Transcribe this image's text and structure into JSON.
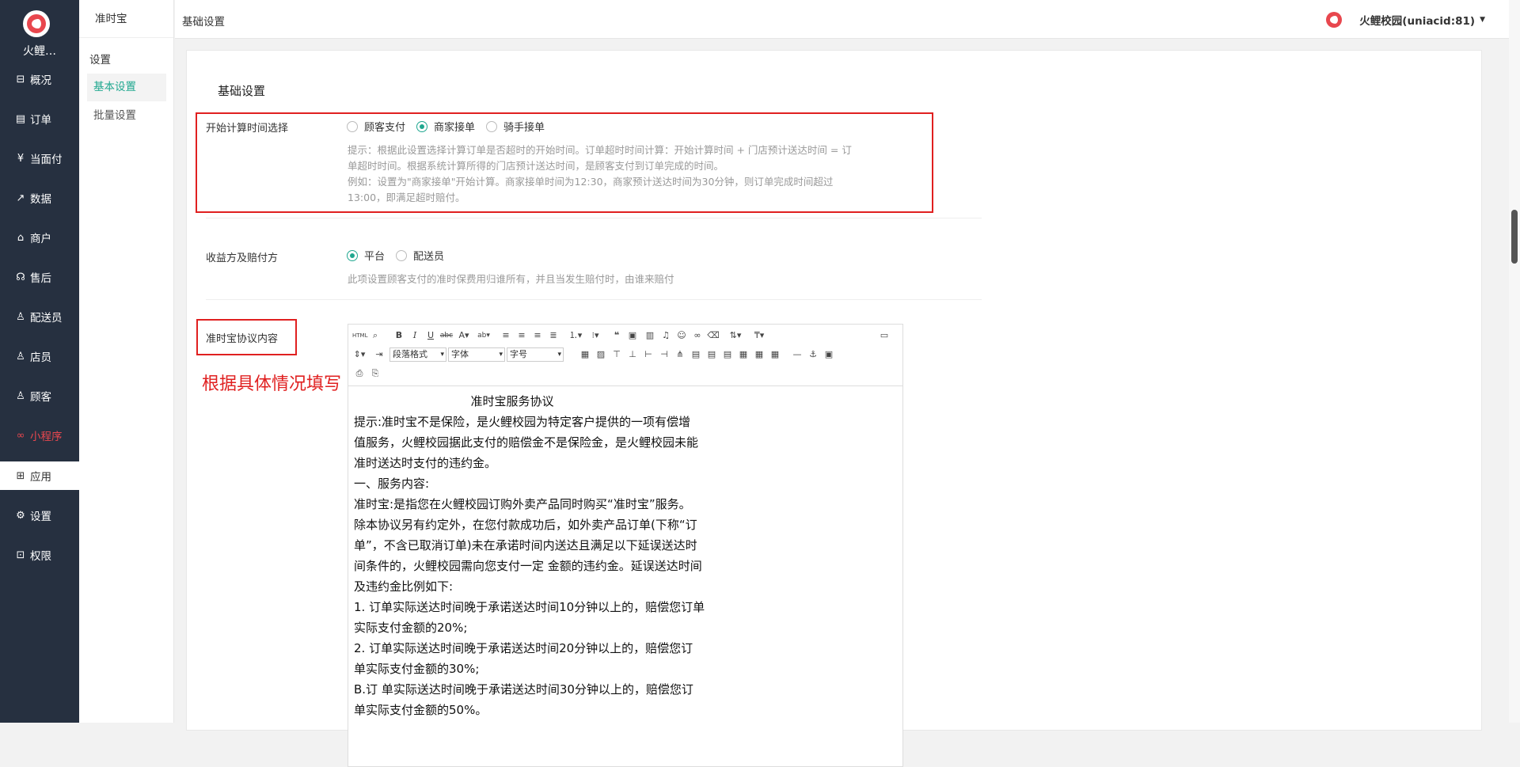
{
  "nav": {
    "brand": "火鲤…",
    "items": [
      {
        "icon": "dashboard-icon",
        "glyph": "⊟",
        "label": "概况"
      },
      {
        "icon": "order-icon",
        "glyph": "▤",
        "label": "订单"
      },
      {
        "icon": "yuan-icon",
        "glyph": "¥",
        "label": "当面付"
      },
      {
        "icon": "chart-icon",
        "glyph": "↗",
        "label": "数据"
      },
      {
        "icon": "shop-icon",
        "glyph": "⌂",
        "label": "商户"
      },
      {
        "icon": "aftersale-icon",
        "glyph": "☊",
        "label": "售后"
      },
      {
        "icon": "courier-icon",
        "glyph": "♙",
        "label": "配送员"
      },
      {
        "icon": "clerk-icon",
        "glyph": "♙",
        "label": "店员"
      },
      {
        "icon": "customer-icon",
        "glyph": "♙",
        "label": "顾客"
      },
      {
        "icon": "miniprogram-icon",
        "glyph": "∞",
        "label": "小程序"
      },
      {
        "icon": "apps-icon",
        "glyph": "⊞",
        "label": "应用"
      },
      {
        "icon": "settings-icon",
        "glyph": "⚙",
        "label": "设置"
      },
      {
        "icon": "lock-icon",
        "glyph": "⊡",
        "label": "权限"
      }
    ]
  },
  "sub": {
    "title": "准时宝",
    "group": "设置",
    "items": [
      "基本设置",
      "批量设置"
    ]
  },
  "header": {
    "breadcrumb": "基础设置",
    "user": "火鲤校园(uniacid:81)"
  },
  "main": {
    "section_title": "基础设置",
    "start_time": {
      "label": "开始计算时间选择",
      "options": [
        "顾客支付",
        "商家接单",
        "骑手接单"
      ],
      "hint1": "提示：根据此设置选择计算订单是否超时的开始时间。订单超时时间计算：开始计算时间 + 门店预计送达时间 = 订",
      "hint2": "单超时时间。根据系统计算所得的门店预计送达时间，是顾客支付到订单完成的时间。",
      "hint3": "例如：设置为\"商家接单\"开始计算。商家接单时间为12:30，商家预计送达时间为30分钟，则订单完成时间超过",
      "hint4": "13:00，即满足超时赔付。"
    },
    "beneficiary": {
      "label": "收益方及赔付方",
      "options": [
        "平台",
        "配送员"
      ],
      "hint": "此项设置顾客支付的准时保费用归谁所有，并且当发生赔付时，由谁来赔付"
    },
    "agreement": {
      "label": "准时宝协议内容",
      "annotation": "根据具体情况填写"
    }
  },
  "editor": {
    "paragraph_format": "段落格式",
    "font": "字体",
    "font_size": "字号",
    "html_label": "HTML",
    "content": [
      "准时宝服务协议",
      "提示:准时宝不是保险，是火鲤校园为特定客户提供的一项有偿增",
      "值服务，火鲤校园据此支付的赔偿金不是保险金，是火鲤校园未能",
      "准时送达时支付的违约金。",
      "一、服务内容:",
      "准时宝:是指您在火鲤校园订购外卖产品同时购买“准时宝”服务。",
      "除本协议另有约定外，在您付款成功后，如外卖产品订单(下称“订",
      "单”，不含已取消订单)未在承诺时间内送达且满足以下延误送达时",
      "间条件的，火鲤校园需向您支付一定 金额的违约金。延误送达时间",
      "及违约金比例如下:",
      "1. 订单实际送达时间晚于承诺送达时间10分钟以上的，赔偿您订单",
      "实际支付金额的20%;",
      "2. 订单实际送达时间晚于承诺送达时间20分钟以上的，赔偿您订",
      "单实际支付金额的30%;",
      "B.订 单实际送达时间晚于承诺送达时间30分钟以上的，赔偿您订",
      "单实际支付金额的50%。"
    ]
  },
  "colors": {
    "accent": "#1fa78f",
    "nav_bg": "#263040",
    "brand_red": "#e8474e",
    "annotation_red": "#e02020"
  }
}
